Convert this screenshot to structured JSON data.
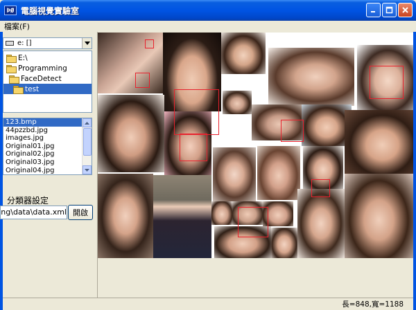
{
  "window": {
    "title": "電腦視覺實驗室",
    "app_icon_text": "ÞØ"
  },
  "menu": {
    "file_label": "檔案(F)"
  },
  "drive": {
    "value": "e: []"
  },
  "dirs": [
    "E:\\",
    "Programming",
    "FaceDetect",
    "test"
  ],
  "files": [
    "123.bmp",
    "44pzzbd.jpg",
    "images.jpg",
    "Original01.jpg",
    "Original02.jpg",
    "Original03.jpg",
    "Original04.jpg"
  ],
  "classifier": {
    "label": "分類器設定",
    "path": "C:\\Programming\\data\\data.xml",
    "open_label": "開啟"
  },
  "status": {
    "text": "長=848,寬=1188"
  },
  "colors": {
    "titlebar": "#0054e3",
    "selection": "#316ac5",
    "face_box": "#e8212d"
  }
}
